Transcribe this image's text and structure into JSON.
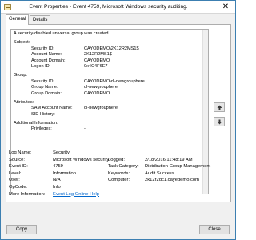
{
  "window": {
    "title": "Event Properties - Event 4759, Microsoft Windows security auditing.",
    "close_glyph": "✕"
  },
  "tabs": [
    {
      "label": "General",
      "active": true
    },
    {
      "label": "Details",
      "active": false
    }
  ],
  "description": {
    "summary": "A security-disabled universal group was created.",
    "sections": [
      {
        "header": "Subject:",
        "rows": [
          {
            "label": "Security ID:",
            "value": "CAYODEMO\\2K12R2MS1$"
          },
          {
            "label": "Account Name:",
            "value": "2K12R2MS1$"
          },
          {
            "label": "Account Domain:",
            "value": "CAYODEMO"
          },
          {
            "label": "Logon ID:",
            "value": "0x4C4F6E7"
          }
        ]
      },
      {
        "header": "Group:",
        "rows": [
          {
            "label": "Security ID:",
            "value": "CAYODEMO\\dl-newgrouphere"
          },
          {
            "label": "Group Name:",
            "value": "dl-newgrouphere"
          },
          {
            "label": "Group Domain:",
            "value": "CAYODEMO"
          }
        ]
      },
      {
        "header": "Attributes:",
        "rows": [
          {
            "label": "SAM Account Name:",
            "value": "dl-newgrouphere"
          },
          {
            "label": "SID History:",
            "value": "-"
          }
        ]
      },
      {
        "header": "Additional Information:",
        "rows": [
          {
            "label": "Privileges:",
            "value": "-"
          }
        ]
      }
    ]
  },
  "details": {
    "log_name_label": "Log Name:",
    "log_name": "Security",
    "source_label": "Source:",
    "source": "Microsoft Windows security",
    "logged_label": "Logged:",
    "logged": "2/18/2016 11:48:19 AM",
    "event_id_label": "Event ID:",
    "event_id": "4759",
    "task_category_label": "Task Category:",
    "task_category": "Distribution Group Management",
    "level_label": "Level:",
    "level": "Information",
    "keywords_label": "Keywords:",
    "keywords": "Audit Success",
    "user_label": "User:",
    "user": "N/A",
    "computer_label": "Computer:",
    "computer": "2k12r2dc1.cayedemo.com",
    "opcode_label": "OpCode:",
    "opcode": "Info",
    "more_info_label": "More Information:",
    "more_info_link": "Event Log Online Help"
  },
  "buttons": {
    "copy": "Copy",
    "close": "Close"
  },
  "icons": {
    "title_icon": "event-viewer-icon",
    "up": "arrow-up-icon",
    "down": "arrow-down-icon"
  }
}
